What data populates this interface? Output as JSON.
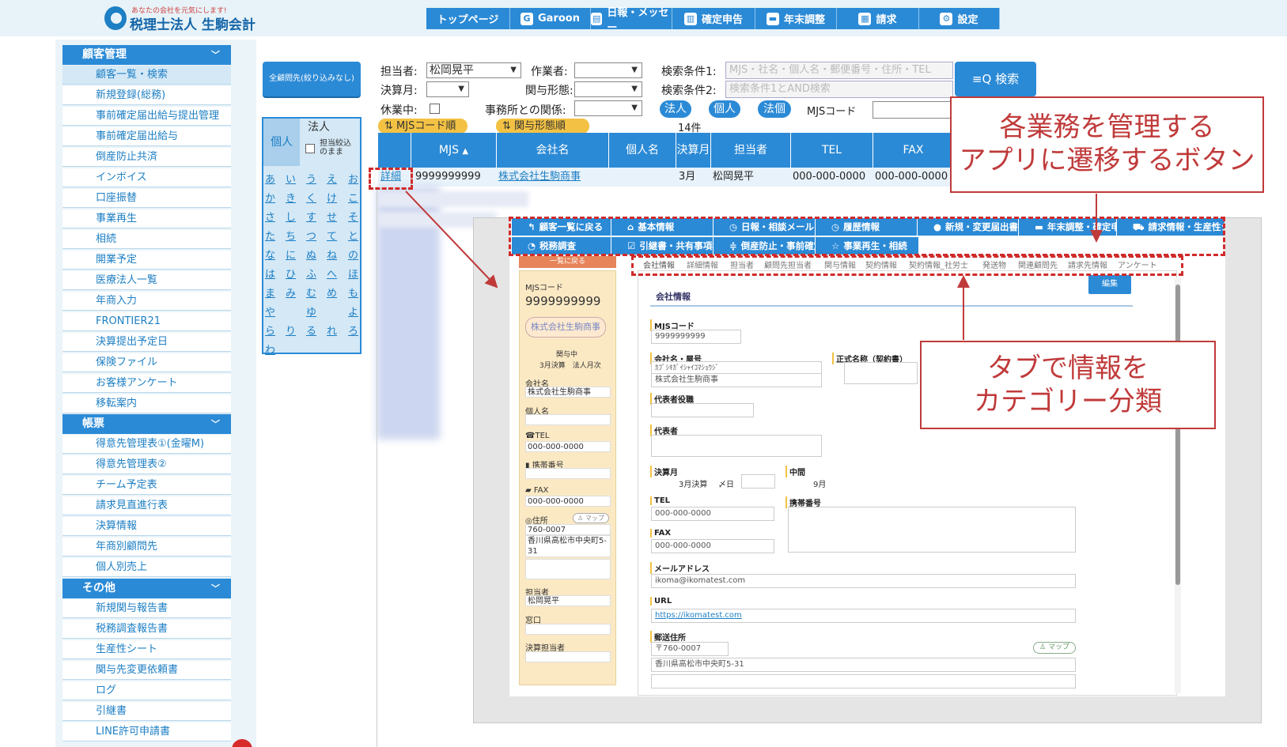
{
  "header": {
    "tagline": "あなたの会社を元気にします!",
    "logo_name": "税理士法人 生駒会計",
    "nav": [
      {
        "label": "トップページ",
        "icon": ""
      },
      {
        "label": "Garoon",
        "icon": "G"
      },
      {
        "label": "日報・メッセー",
        "icon": "▤"
      },
      {
        "label": "確定申告",
        "icon": "▥"
      },
      {
        "label": "年末調整",
        "icon": "▬"
      },
      {
        "label": "請求",
        "icon": "▦"
      },
      {
        "label": "設定",
        "icon": "⚙"
      }
    ]
  },
  "sidebar": {
    "sec1": "顧客管理",
    "items1": [
      "顧客一覧・検索",
      "新規登録(総務)",
      "事前確定届出給与提出管理",
      "事前確定届出給与",
      "倒産防止共済",
      "インボイス",
      "口座振替",
      "事業再生",
      "相続",
      "開業予定",
      "医療法人一覧",
      "年商入力",
      "FRONTIER21",
      "決算提出予定日",
      "保険ファイル",
      "お客様アンケート",
      "移転案内"
    ],
    "sec2": "帳票",
    "items2": [
      "得意先管理表①(金曜M)",
      "得意先管理表②",
      "チーム予定表",
      "請求見直進行表",
      "決算情報",
      "年商別顧問先",
      "個人別売上"
    ],
    "sec3": "その他",
    "items3": [
      "新規関与報告書",
      "税務調査報告書",
      "生産性シート",
      "関与先変更依頼書",
      "ログ",
      "引継書",
      "LINE許可申請書"
    ]
  },
  "filters": {
    "all_button": "全顧問先(絞り込みなし)",
    "tab_kojin": "個人",
    "tab_hojin": "法人",
    "keep_label": "担当絞込のまま",
    "kana": [
      "あ",
      "い",
      "う",
      "え",
      "お",
      "か",
      "き",
      "く",
      "け",
      "こ",
      "さ",
      "し",
      "す",
      "せ",
      "そ",
      "た",
      "ち",
      "つ",
      "て",
      "と",
      "な",
      "に",
      "ぬ",
      "ね",
      "の",
      "は",
      "ひ",
      "ふ",
      "へ",
      "ほ",
      "ま",
      "み",
      "む",
      "め",
      "も",
      "や",
      "ゆ",
      "よ",
      "ら",
      "り",
      "る",
      "れ",
      "ろ",
      "わ"
    ]
  },
  "search": {
    "tantou_label": "担当者:",
    "tantou_value": "松岡晃平",
    "sagyou_label": "作業者:",
    "kensaku1_label": "検索条件1:",
    "kensaku1_placeholder": "MJS・社名・個人名・郵便番号・住所・TEL",
    "kensaku2_label": "検索条件2:",
    "kensaku2_placeholder": "検索条件1とAND検索",
    "kessan_label": "決算月:",
    "kanyo_label": "関与形態:",
    "kyugyo_label": "休業中:",
    "jimusho_label": "事務所との関係:",
    "search_button": "検索",
    "pills": [
      "法人",
      "個人",
      "法個"
    ],
    "mjs_code_label": "MJSコード",
    "sort_mjs": "MJSコード順",
    "sort_kanyo": "関与形態順",
    "count": "14件"
  },
  "table": {
    "headers": [
      "MJS",
      "会社名",
      "個人名",
      "決算月",
      "担当者",
      "TEL",
      "FAX"
    ],
    "row": {
      "detail": "詳細",
      "mjs": "9999999999",
      "company": "株式会社生駒商事",
      "month": "3月",
      "tantou": "松岡晃平",
      "tel": "000-000-0000",
      "fax": "000-000-0000"
    }
  },
  "detail": {
    "toolbar1": [
      {
        "label": "顧客一覧に戻る",
        "icon": "↰"
      },
      {
        "label": "基本情報",
        "icon": "⌂"
      },
      {
        "label": "日報・相談メール",
        "icon": "◷"
      },
      {
        "label": "履歴情報",
        "icon": "◷"
      },
      {
        "label": "新規・変更届出書",
        "icon": "●"
      },
      {
        "label": "年末調整・確定申告",
        "icon": "▬"
      },
      {
        "label": "請求情報・生産性シ-",
        "icon": "⛟"
      }
    ],
    "toolbar2": [
      {
        "label": "税務調査",
        "icon": "◔"
      },
      {
        "label": "引継書・共有事項報",
        "icon": "☑"
      },
      {
        "label": "倒産防止・事前確定",
        "icon": "≑"
      },
      {
        "label": "事業再生・相続",
        "icon": "☆"
      }
    ],
    "tabs": [
      "会社情報",
      "詳細情報",
      "担当者",
      "顧問先担当者",
      "関与情報",
      "契約情報",
      "契約情報_社労士",
      "発送物",
      "関連顧問先",
      "請求先情報",
      "アンケート"
    ],
    "back": "一覧に戻る",
    "card": {
      "mjs_label": "MJSコード",
      "mjs": "9999999999",
      "company_badge": "株式会社生駒商事",
      "status": "関与中",
      "status2": "3月決算　法人月次",
      "f_company": "会社名",
      "v_company": "株式会社生駒商事",
      "f_person": "個人名",
      "f_tel": "☎TEL",
      "v_tel": "000-000-0000",
      "f_mobile": "携帯番号",
      "f_fax": "FAX",
      "v_fax": "000-000-0000",
      "f_addr": "住所",
      "map": "マップ",
      "v_zip": "760-0007",
      "v_addr": "香川県高松市中央町5-31",
      "f_tantou": "担当者",
      "v_tantou": "松岡晃平",
      "f_window": "窓口",
      "f_kessan_tantou": "決算担当者"
    },
    "main": {
      "title": "会社情報",
      "edit": "編集",
      "f_mjs": "MJSコード",
      "v_mjs": "9999999999",
      "f_company": "会社名・屋号",
      "v_kana": "ｶﾌﾞｼｷｶﾞｲｼｬｲｺﾏｼｮｳｼﾞ",
      "v_company": "株式会社生駒商事",
      "f_official": "正式名称（契約書）",
      "f_rep_title": "代表者役職",
      "f_rep": "代表者",
      "f_kessan": "決算月",
      "v_kessan": "3月決算",
      "v_shime": "〆日",
      "f_chukan": "中間",
      "v_chukan": "9月",
      "f_tel": "TEL",
      "v_tel": "000-000-0000",
      "f_mobile": "携帯番号",
      "f_fax": "FAX",
      "v_fax": "000-000-0000",
      "f_mail": "メールアドレス",
      "v_mail": "ikoma@ikomatest.com",
      "f_url": "URL",
      "v_url": "https://ikomatest.com",
      "f_send": "郵送住所",
      "v_zip": "〒760-0007",
      "map": "マップ",
      "v_addr": "香川県高松市中央町5-31"
    }
  },
  "callouts": {
    "c1": [
      "各業務を管理する",
      "アプリに遷移するボタン"
    ],
    "c2": [
      "タブで情報を",
      "カテゴリー分類"
    ]
  },
  "colors": {
    "accent": "#2b8ad6",
    "callout": "#c03a3a"
  }
}
